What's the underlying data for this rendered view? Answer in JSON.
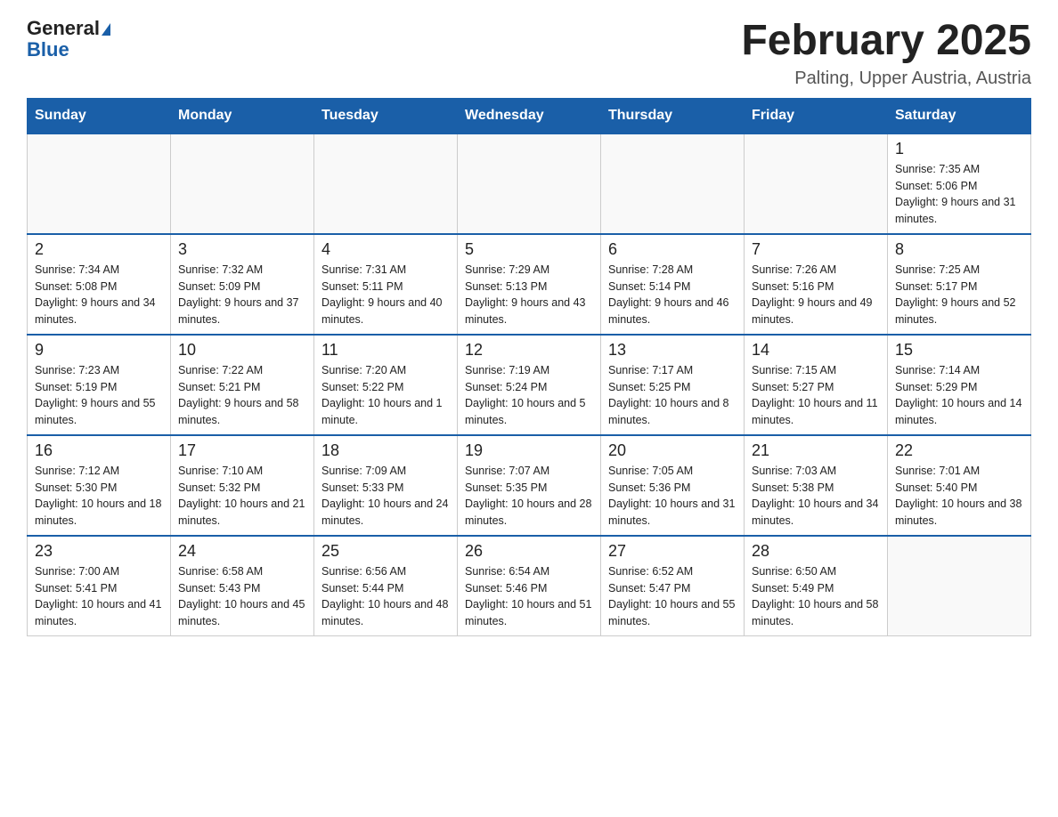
{
  "header": {
    "logo_general": "General",
    "logo_blue": "Blue",
    "title": "February 2025",
    "subtitle": "Palting, Upper Austria, Austria"
  },
  "weekdays": [
    "Sunday",
    "Monday",
    "Tuesday",
    "Wednesday",
    "Thursday",
    "Friday",
    "Saturday"
  ],
  "weeks": [
    [
      {
        "day": "",
        "info": ""
      },
      {
        "day": "",
        "info": ""
      },
      {
        "day": "",
        "info": ""
      },
      {
        "day": "",
        "info": ""
      },
      {
        "day": "",
        "info": ""
      },
      {
        "day": "",
        "info": ""
      },
      {
        "day": "1",
        "info": "Sunrise: 7:35 AM\nSunset: 5:06 PM\nDaylight: 9 hours and 31 minutes."
      }
    ],
    [
      {
        "day": "2",
        "info": "Sunrise: 7:34 AM\nSunset: 5:08 PM\nDaylight: 9 hours and 34 minutes."
      },
      {
        "day": "3",
        "info": "Sunrise: 7:32 AM\nSunset: 5:09 PM\nDaylight: 9 hours and 37 minutes."
      },
      {
        "day": "4",
        "info": "Sunrise: 7:31 AM\nSunset: 5:11 PM\nDaylight: 9 hours and 40 minutes."
      },
      {
        "day": "5",
        "info": "Sunrise: 7:29 AM\nSunset: 5:13 PM\nDaylight: 9 hours and 43 minutes."
      },
      {
        "day": "6",
        "info": "Sunrise: 7:28 AM\nSunset: 5:14 PM\nDaylight: 9 hours and 46 minutes."
      },
      {
        "day": "7",
        "info": "Sunrise: 7:26 AM\nSunset: 5:16 PM\nDaylight: 9 hours and 49 minutes."
      },
      {
        "day": "8",
        "info": "Sunrise: 7:25 AM\nSunset: 5:17 PM\nDaylight: 9 hours and 52 minutes."
      }
    ],
    [
      {
        "day": "9",
        "info": "Sunrise: 7:23 AM\nSunset: 5:19 PM\nDaylight: 9 hours and 55 minutes."
      },
      {
        "day": "10",
        "info": "Sunrise: 7:22 AM\nSunset: 5:21 PM\nDaylight: 9 hours and 58 minutes."
      },
      {
        "day": "11",
        "info": "Sunrise: 7:20 AM\nSunset: 5:22 PM\nDaylight: 10 hours and 1 minute."
      },
      {
        "day": "12",
        "info": "Sunrise: 7:19 AM\nSunset: 5:24 PM\nDaylight: 10 hours and 5 minutes."
      },
      {
        "day": "13",
        "info": "Sunrise: 7:17 AM\nSunset: 5:25 PM\nDaylight: 10 hours and 8 minutes."
      },
      {
        "day": "14",
        "info": "Sunrise: 7:15 AM\nSunset: 5:27 PM\nDaylight: 10 hours and 11 minutes."
      },
      {
        "day": "15",
        "info": "Sunrise: 7:14 AM\nSunset: 5:29 PM\nDaylight: 10 hours and 14 minutes."
      }
    ],
    [
      {
        "day": "16",
        "info": "Sunrise: 7:12 AM\nSunset: 5:30 PM\nDaylight: 10 hours and 18 minutes."
      },
      {
        "day": "17",
        "info": "Sunrise: 7:10 AM\nSunset: 5:32 PM\nDaylight: 10 hours and 21 minutes."
      },
      {
        "day": "18",
        "info": "Sunrise: 7:09 AM\nSunset: 5:33 PM\nDaylight: 10 hours and 24 minutes."
      },
      {
        "day": "19",
        "info": "Sunrise: 7:07 AM\nSunset: 5:35 PM\nDaylight: 10 hours and 28 minutes."
      },
      {
        "day": "20",
        "info": "Sunrise: 7:05 AM\nSunset: 5:36 PM\nDaylight: 10 hours and 31 minutes."
      },
      {
        "day": "21",
        "info": "Sunrise: 7:03 AM\nSunset: 5:38 PM\nDaylight: 10 hours and 34 minutes."
      },
      {
        "day": "22",
        "info": "Sunrise: 7:01 AM\nSunset: 5:40 PM\nDaylight: 10 hours and 38 minutes."
      }
    ],
    [
      {
        "day": "23",
        "info": "Sunrise: 7:00 AM\nSunset: 5:41 PM\nDaylight: 10 hours and 41 minutes."
      },
      {
        "day": "24",
        "info": "Sunrise: 6:58 AM\nSunset: 5:43 PM\nDaylight: 10 hours and 45 minutes."
      },
      {
        "day": "25",
        "info": "Sunrise: 6:56 AM\nSunset: 5:44 PM\nDaylight: 10 hours and 48 minutes."
      },
      {
        "day": "26",
        "info": "Sunrise: 6:54 AM\nSunset: 5:46 PM\nDaylight: 10 hours and 51 minutes."
      },
      {
        "day": "27",
        "info": "Sunrise: 6:52 AM\nSunset: 5:47 PM\nDaylight: 10 hours and 55 minutes."
      },
      {
        "day": "28",
        "info": "Sunrise: 6:50 AM\nSunset: 5:49 PM\nDaylight: 10 hours and 58 minutes."
      },
      {
        "day": "",
        "info": ""
      }
    ]
  ]
}
